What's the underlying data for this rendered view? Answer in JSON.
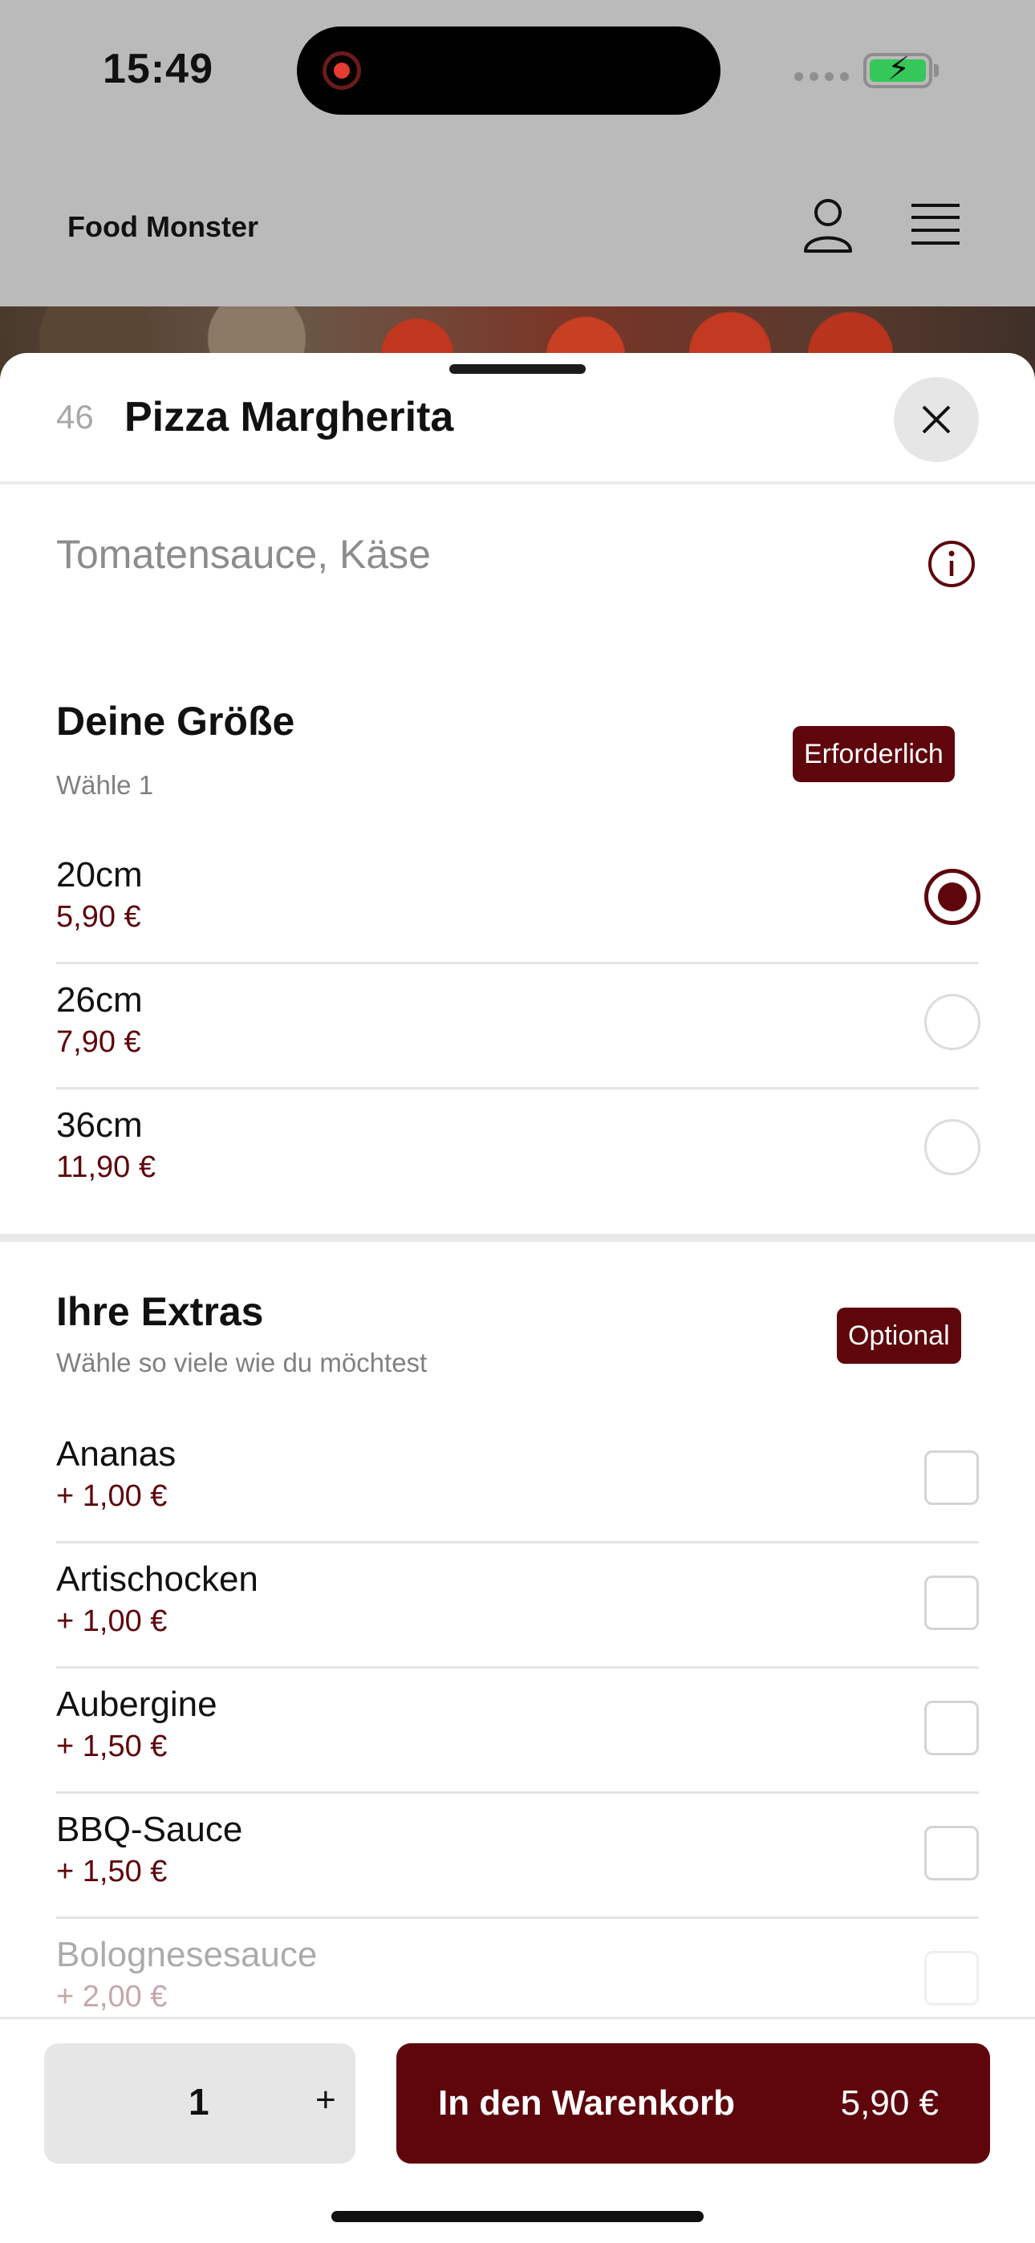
{
  "status_bar": {
    "time": "15:49"
  },
  "header": {
    "title": "Food Monster"
  },
  "item": {
    "number": "46",
    "name": "Pizza Margherita",
    "description": "Tomatensauce, Käse"
  },
  "size_section": {
    "title": "Deine Größe",
    "subtitle": "Wähle 1",
    "badge": "Erforderlich",
    "options": [
      {
        "label": "20cm",
        "price": "5,90 €",
        "selected": true
      },
      {
        "label": "26cm",
        "price": "7,90 €",
        "selected": false
      },
      {
        "label": "36cm",
        "price": "11,90 €",
        "selected": false
      }
    ]
  },
  "extras_section": {
    "title": "Ihre Extras",
    "subtitle": "Wähle so viele wie du möchtest",
    "badge": "Optional",
    "options": [
      {
        "label": "Ananas",
        "price": "+ 1,00 €",
        "checked": false
      },
      {
        "label": "Artischocken",
        "price": "+ 1,00 €",
        "checked": false
      },
      {
        "label": "Aubergine",
        "price": "+ 1,50 €",
        "checked": false
      },
      {
        "label": "BBQ-Sauce",
        "price": "+ 1,50 €",
        "checked": false
      },
      {
        "label": "Bolognesesauce",
        "price": "+ 2,00 €",
        "checked": false
      }
    ]
  },
  "footer": {
    "quantity": "1",
    "plus": "+",
    "cart_label": "In den Warenkorb",
    "cart_price": "5,90 €"
  },
  "colors": {
    "accent": "#5e060c",
    "success": "#35c759"
  },
  "icons": [
    "user-icon",
    "menu-icon",
    "close-icon",
    "info-icon",
    "battery-icon",
    "record-icon"
  ]
}
